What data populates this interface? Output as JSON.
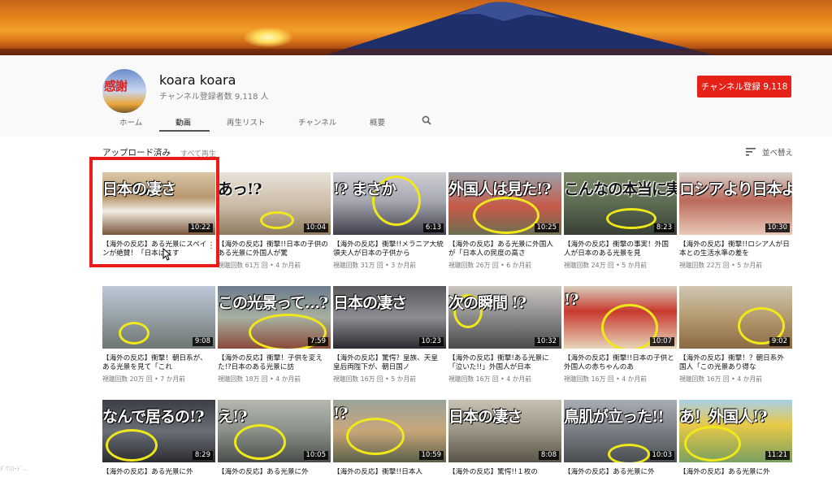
{
  "channel": {
    "avatar_text": "感謝",
    "name": "koara koara",
    "subscribers": "チャンネル登録者数 9,118 人",
    "subscribe_label": "チャンネル登録  9,118"
  },
  "tabs": [
    {
      "label": "ホーム"
    },
    {
      "label": "動画"
    },
    {
      "label": "再生リスト"
    },
    {
      "label": "チャンネル"
    },
    {
      "label": "概要"
    }
  ],
  "section": {
    "title": "アップロード済み",
    "play_all": "すべて再生",
    "sort_label": "並べ替え"
  },
  "videos": [
    {
      "thumb_text": "日本の凄さ",
      "duration": "10:22",
      "title": "【海外の反応】ある光景にスペインが絶賛！「日本はさす",
      "views": "",
      "age": ""
    },
    {
      "thumb_text": "あっ!?",
      "duration": "10:04",
      "title": "【海外の反応】衝撃!!日本の子供のある光景に外国人が驚",
      "views": "視聴回数 61万 回",
      "age": "4 か月前"
    },
    {
      "thumb_text": "!? まさか",
      "duration": "6:13",
      "title": "【海外の反応】衝撃!!メラニア大統領夫人が日本の子供から",
      "views": "視聴回数 31万 回",
      "age": "3 か月前"
    },
    {
      "thumb_text": "外国人は見た!?",
      "duration": "10:25",
      "title": "【海外の反応】ある光景に外国人が「日本人の民度の高さ",
      "views": "視聴回数 26万 回",
      "age": "6 か月前"
    },
    {
      "thumb_text": "こんなの本当に実在するの?",
      "duration": "8:23",
      "title": "【海外の反応】衝撃の事実！外国人が日本のある光景を見",
      "views": "視聴回数 24万 回",
      "age": "5 か月前"
    },
    {
      "thumb_text": "ロシアより日本よ!!",
      "duration": "10:30",
      "title": "【海外の反応】衝撃!!ロシア人が日本との生活水準の差を",
      "views": "視聴回数 22万 回",
      "age": "5 か月前"
    },
    {
      "thumb_text": "",
      "duration": "9:08",
      "title": "【海外の反応】衝撃！朝日系が、ある光景を見て「これ",
      "views": "視聴回数 20万 回",
      "age": "7 か月前"
    },
    {
      "thumb_text": "この光景って…?",
      "duration": "7:59",
      "title": "【海外の反応】衝撃！子供を変えた!?日本のある光景に訪",
      "views": "視聴回数 18万 回",
      "age": "4 か月前"
    },
    {
      "thumb_text": "日本の凄さ",
      "duration": "10:23",
      "title": "【海外の反応】驚愕？皇族、天皇皇后両陛下が、朝日国ノ",
      "views": "視聴回数 16万 回",
      "age": "5 か月前"
    },
    {
      "thumb_text": "次の瞬間 !?",
      "duration": "10:32",
      "title": "【海外の反応】衝撃!ある光景に「泣いた!!」外国人が日本",
      "views": "視聴回数 16万 回",
      "age": "4 か月前"
    },
    {
      "thumb_text": "!?",
      "duration": "10:07",
      "title": "【海外の反応】衝撃!!日本の子供と外国人の赤ちゃんのあ",
      "views": "視聴回数 16万 回",
      "age": "4 か月前"
    },
    {
      "thumb_text": "",
      "duration": "9:02",
      "title": "【海外の反応】衝撃！？朝日系外国人「この光景あり得な",
      "views": "視聴回数 16万 回",
      "age": "4 か月前"
    },
    {
      "thumb_text": "なんで居るの!?",
      "duration": "8:29",
      "title": "【海外の反応】ある光景に外",
      "views": "",
      "age": ""
    },
    {
      "thumb_text": "え!?",
      "duration": "10:05",
      "title": "【海外の反応】ある光景に外",
      "views": "",
      "age": ""
    },
    {
      "thumb_text": "!?",
      "duration": "10:59",
      "title": "【海外の反応】衝撃!!日本人",
      "views": "",
      "age": ""
    },
    {
      "thumb_text": "日本の凄さ",
      "duration": "8:08",
      "title": "【海外の反応】驚愕!!１枚の",
      "views": "",
      "age": ""
    },
    {
      "thumb_text": "鳥肌が立った!!",
      "duration": "10:03",
      "title": "【海外の反応】ある光景に外",
      "views": "",
      "age": ""
    },
    {
      "thumb_text": "あ！外国人!?",
      "duration": "11:21",
      "title": "【海外の反応】ある光景に外",
      "views": "",
      "age": ""
    }
  ],
  "status_text": "ﾀﾞｳﾝﾛｰﾄﾞ..."
}
